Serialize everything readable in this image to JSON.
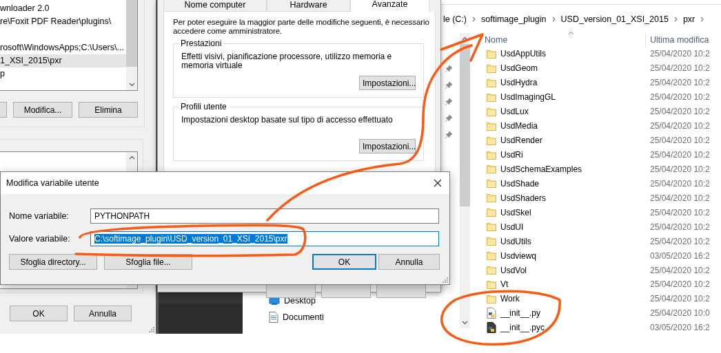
{
  "env_window": {
    "list_rows": [
      {
        "kind": "text",
        "text": "wnloader 2.0",
        "selected": false
      },
      {
        "kind": "text",
        "text": "re\\Foxit PDF Reader\\plugins\\",
        "selected": false
      },
      {
        "kind": "blank"
      },
      {
        "kind": "text",
        "text": "rosoft\\WindowsApps;C:\\Users\\...",
        "selected": false
      },
      {
        "kind": "text",
        "text": "1_XSI_2015\\pxr",
        "selected": true
      },
      {
        "kind": "text",
        "text": "p",
        "selected": false
      }
    ],
    "list_buttons": [
      "Modifica...",
      "Elimina"
    ],
    "footer_buttons": [
      "OK",
      "Annulla"
    ]
  },
  "system_properties": {
    "tabs": [
      {
        "label": "Nome computer",
        "selected": false
      },
      {
        "label": "Hardware",
        "selected": false
      },
      {
        "label": "Avanzate",
        "selected": true
      }
    ],
    "intro": "Per poter eseguire la maggior parte delle modifiche seguenti, è necessario accedere come amministratore.",
    "groups": [
      {
        "title": "Prestazioni",
        "text": "Effetti visivi, pianificazione processore, utilizzo memoria e memoria virtuale",
        "button": "Impostazioni..."
      },
      {
        "title": "Profili utente",
        "text": "Impostazioni desktop basate sul tipo di accesso effettuato",
        "button": "Impostazioni..."
      }
    ]
  },
  "explorer": {
    "breadcrumb": [
      "le (C:)",
      "softimage_plugin",
      "USD_version_01_XSI_2015",
      "pxr"
    ],
    "columns": [
      "Nome",
      "Ultima modifica"
    ],
    "files": [
      {
        "kind": "folder",
        "name": "UsdAppUtils",
        "date": "25/04/2020 10:2"
      },
      {
        "kind": "folder",
        "name": "UsdGeom",
        "date": "25/04/2020 10:2"
      },
      {
        "kind": "folder",
        "name": "UsdHydra",
        "date": "25/04/2020 10:2"
      },
      {
        "kind": "folder",
        "name": "UsdImagingGL",
        "date": "25/04/2020 10:2"
      },
      {
        "kind": "folder",
        "name": "UsdLux",
        "date": "25/04/2020 10:2"
      },
      {
        "kind": "folder",
        "name": "UsdMedia",
        "date": "25/04/2020 10:2"
      },
      {
        "kind": "folder",
        "name": "UsdRender",
        "date": "25/04/2020 10:2"
      },
      {
        "kind": "folder",
        "name": "UsdRi",
        "date": "25/04/2020 10:2"
      },
      {
        "kind": "folder",
        "name": "UsdSchemaExamples",
        "date": "25/04/2020 10:2"
      },
      {
        "kind": "folder",
        "name": "UsdShade",
        "date": "25/04/2020 10:2"
      },
      {
        "kind": "folder",
        "name": "UsdShaders",
        "date": "25/04/2020 10:2"
      },
      {
        "kind": "folder",
        "name": "UsdSkel",
        "date": "25/04/2020 10:2"
      },
      {
        "kind": "folder",
        "name": "UsdUI",
        "date": "25/04/2020 10:2"
      },
      {
        "kind": "folder",
        "name": "UsdUtils",
        "date": "25/04/2020 10:2"
      },
      {
        "kind": "folder",
        "name": "Usdviewq",
        "date": "03/05/2020 16:2"
      },
      {
        "kind": "folder",
        "name": "UsdVol",
        "date": "25/04/2020 10:2"
      },
      {
        "kind": "folder",
        "name": "Vt",
        "date": "25/04/2020 10:2"
      },
      {
        "kind": "folder",
        "name": "Work",
        "date": "25/04/2020 10:2"
      },
      {
        "kind": "py",
        "name": "__init__.py",
        "date": "25/04/2020 10:0"
      },
      {
        "kind": "pyc",
        "name": "__init__.pyc",
        "date": "03/05/2020 16:2"
      }
    ],
    "nav_items": [
      {
        "kind": "desktop",
        "label": "Desktop"
      },
      {
        "kind": "documents",
        "label": "Documenti"
      }
    ]
  },
  "dialog": {
    "title": "Modifica variabile utente",
    "fields": [
      {
        "label": "Nome variabile:",
        "value": "PYTHONPATH",
        "focused": false,
        "text_selected": false
      },
      {
        "label": "Valore variabile:",
        "value": "C:\\softimage_plugin\\USD_version_01_XSI_2015\\pxr",
        "focused": true,
        "text_selected": true
      }
    ],
    "left_buttons": [
      "Sfoglia directory...",
      "Sfoglia file..."
    ],
    "right_buttons": [
      {
        "label": "OK",
        "default": true
      },
      {
        "label": "Annulla",
        "default": false
      }
    ]
  }
}
